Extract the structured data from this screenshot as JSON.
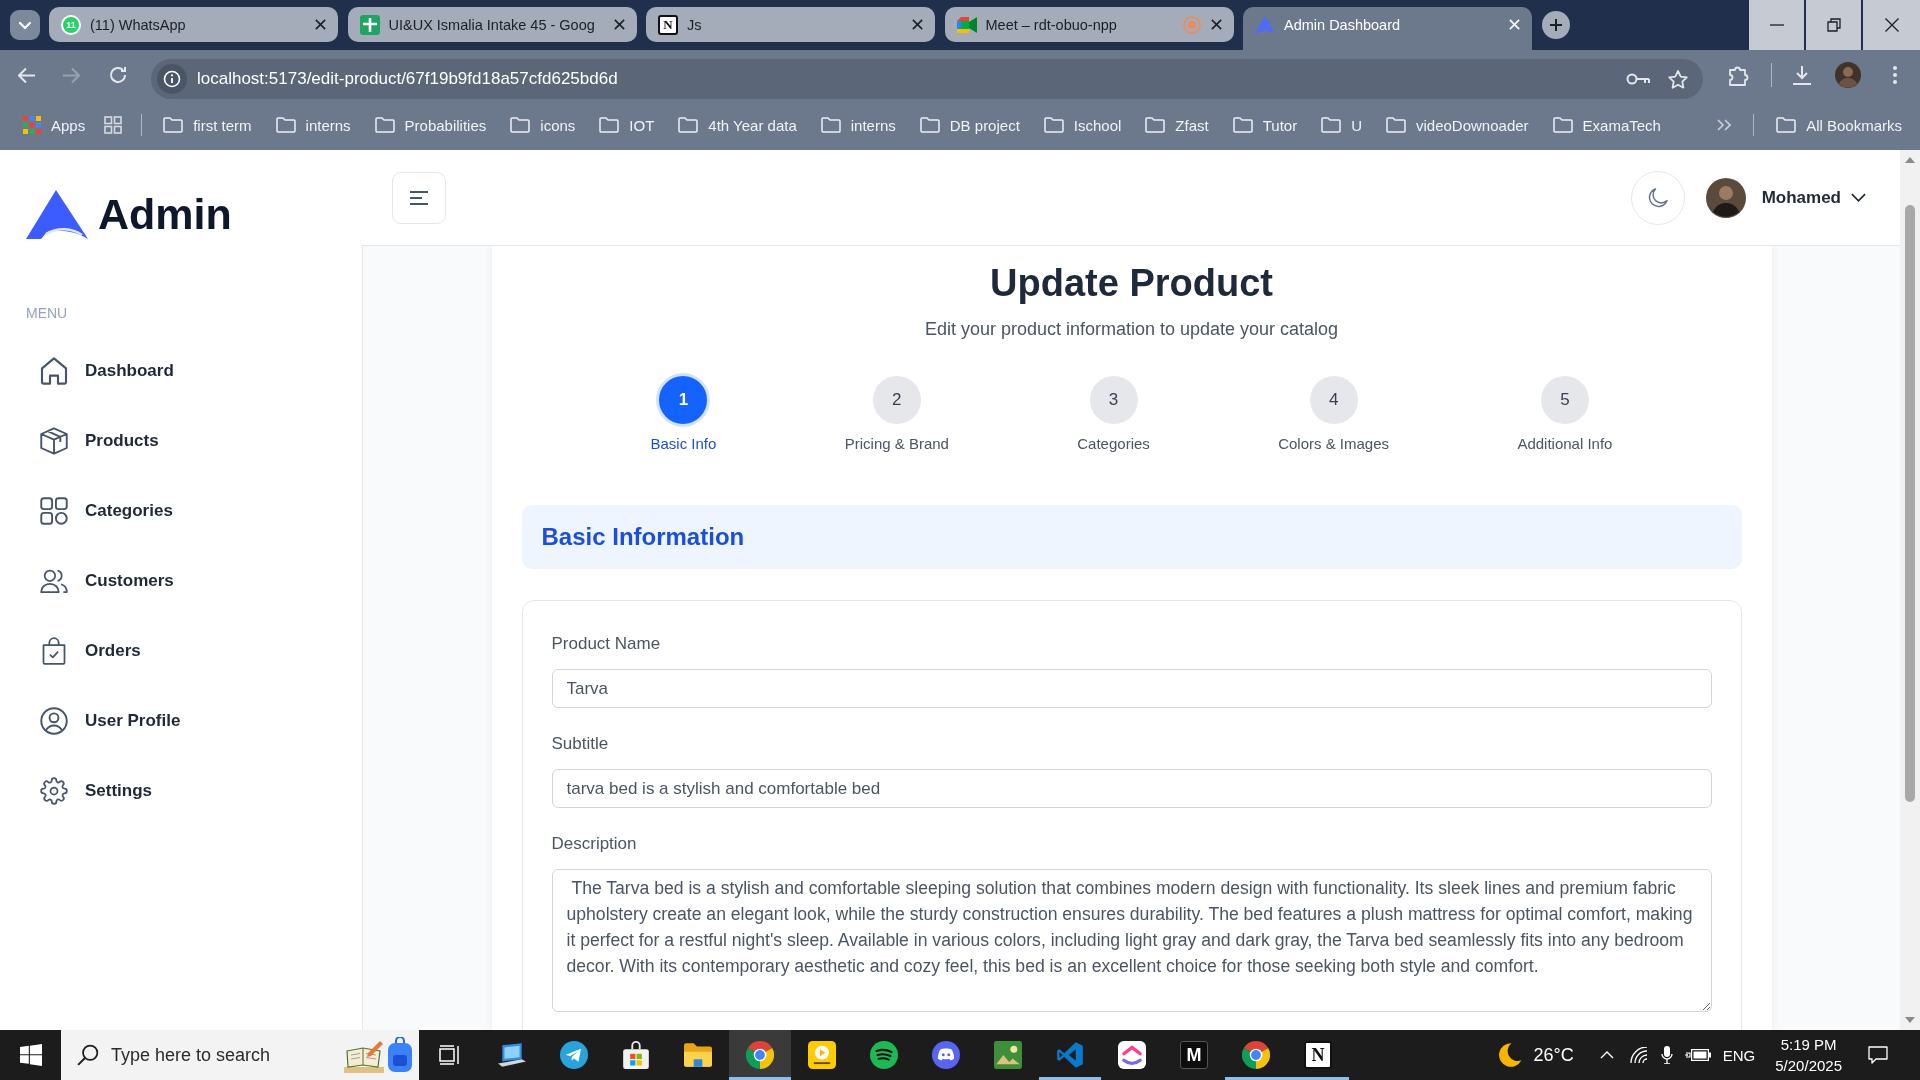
{
  "browser": {
    "tabs": [
      {
        "title": "(11) WhatsApp",
        "kind": "chat",
        "favicon_text": "11",
        "recording": false,
        "selected": false
      },
      {
        "title": "UI&UX Ismalia Intake 45 - Goog",
        "kind": "sheet",
        "recording": false,
        "selected": false
      },
      {
        "title": "Js",
        "kind": "letter",
        "favicon_text": "N",
        "recording": false,
        "selected": false
      },
      {
        "title": "Meet – rdt-obuo-npp",
        "kind": "meet",
        "recording": true,
        "selected": false
      },
      {
        "title": "Admin Dashboard",
        "kind": "logo",
        "recording": false,
        "selected": true
      }
    ],
    "url": "localhost:5173/edit-product/67f19b9fd18a57cfd625bd6d",
    "apps_label": "Apps",
    "folders": [
      "first term",
      "interns",
      "Probabilities",
      "icons",
      "IOT",
      "4th Year data",
      "interns",
      "DB project",
      "Ischool",
      "Zfast",
      "Tutor",
      "U",
      "videoDownoader",
      "ExamaTech"
    ],
    "all_bookmarks": "All Bookmarks"
  },
  "sidebar": {
    "logo": "Admin",
    "menu_heading": "MENU",
    "items": [
      {
        "label": "Dashboard",
        "selected": false
      },
      {
        "label": "Products",
        "selected": false
      },
      {
        "label": "Categories",
        "selected": false
      },
      {
        "label": "Customers",
        "selected": false
      },
      {
        "label": "Orders",
        "selected": false
      },
      {
        "label": "User Profile",
        "selected": false
      },
      {
        "label": "Settings",
        "selected": false
      }
    ]
  },
  "header": {
    "user_name": "Mohamed"
  },
  "page": {
    "title": "Update Product",
    "subtitle": "Edit your product information to update your catalog",
    "steps": [
      {
        "number": "1",
        "label": "Basic Info",
        "selected": true
      },
      {
        "number": "2",
        "label": "Pricing & Brand",
        "selected": false
      },
      {
        "number": "3",
        "label": "Categories",
        "selected": false
      },
      {
        "number": "4",
        "label": "Colors & Images",
        "selected": false
      },
      {
        "number": "5",
        "label": "Additional Info",
        "selected": false
      }
    ],
    "section_title": "Basic Information",
    "fields": [
      {
        "label": "Product Name",
        "value": "Tarva",
        "kind": "input"
      },
      {
        "label": "Subtitle",
        "value": "tarva bed is a stylish and comfortable bed",
        "kind": "input"
      },
      {
        "label": "Description",
        "value": " The Tarva bed is a stylish and comfortable sleeping solution that combines modern design with functionality. Its sleek lines and premium fabric upholstery create an elegant look, while the sturdy construction ensures durability. The bed features a plush mattress for optimal comfort, making it perfect for a restful night's sleep. Available in various colors, including light gray and dark gray, the Tarva bed seamlessly fits into any bedroom decor. With its contemporary aesthetic and cozy feel, this bed is an excellent choice for those seeking both style and comfort.",
        "kind": "textarea"
      }
    ]
  },
  "taskbar": {
    "search": {
      "placeholder": "Type here to search"
    },
    "apps": [
      {
        "kind": "laptop",
        "running": false,
        "selected": false
      },
      {
        "kind": "plane",
        "running": false,
        "selected": false
      },
      {
        "kind": "store",
        "running": false,
        "selected": false
      },
      {
        "kind": "folder",
        "running": false,
        "selected": false
      },
      {
        "kind": "chrome",
        "running": true,
        "selected": true
      },
      {
        "kind": "player",
        "running": false,
        "selected": false
      },
      {
        "kind": "music",
        "running": false,
        "selected": false
      },
      {
        "kind": "controller",
        "running": false,
        "selected": false
      },
      {
        "kind": "photo",
        "running": false,
        "selected": false
      },
      {
        "kind": "code",
        "running": true,
        "selected": false
      },
      {
        "kind": "chevron",
        "running": false,
        "selected": false
      },
      {
        "kind": "darktile",
        "letter": "M",
        "running": false,
        "selected": false
      },
      {
        "kind": "chrome",
        "running": true,
        "selected": false
      },
      {
        "kind": "lighttile",
        "letter": "N",
        "running": true,
        "selected": false
      }
    ],
    "weather": "26°C",
    "language": "ENG",
    "time": "5:19 PM",
    "date": "5/20/2025"
  }
}
